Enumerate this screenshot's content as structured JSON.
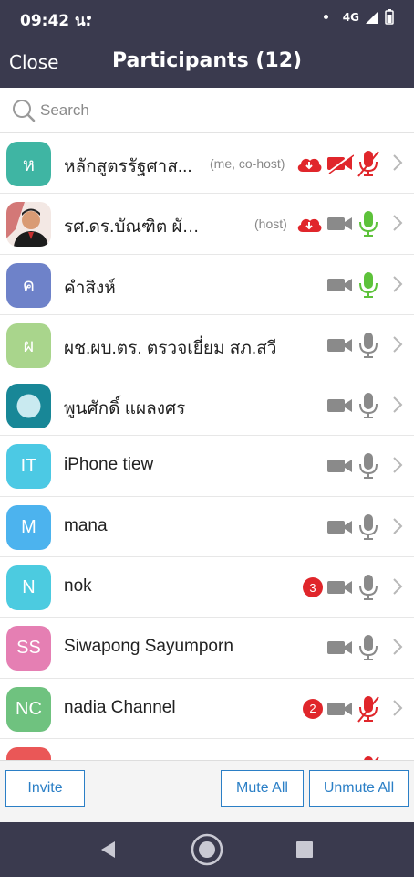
{
  "status_bar": {
    "time": "09:42 น.",
    "network": "4G"
  },
  "header": {
    "close_label": "Close",
    "title": "Participants (12)"
  },
  "search": {
    "placeholder": "Search"
  },
  "colors": {
    "header_bg": "#3a3a4e",
    "accent_blue": "#2b7fc6",
    "red": "#e0262b",
    "green": "#5dc23a",
    "gray_icon": "#8a8a8a"
  },
  "participants": [
    {
      "initials": "ห",
      "avatar_color": "#3fb5a3",
      "name": "หลักสูตรรัฐศาส...",
      "role": "(me, co-host)",
      "cloud": true,
      "video": "off",
      "mic": "muted",
      "chat_badge": ""
    },
    {
      "initials": "",
      "avatar_color": "photo",
      "name": "รศ.ดร.บัณฑิต ผังนิรัน...",
      "role": "(host)",
      "cloud": true,
      "video": "on",
      "mic": "active",
      "chat_badge": ""
    },
    {
      "initials": "ค",
      "avatar_color": "#6e82c9",
      "name": "คำสิงห์",
      "role": "",
      "cloud": false,
      "video": "on",
      "mic": "active",
      "chat_badge": ""
    },
    {
      "initials": "ผ",
      "avatar_color": "#a9d58c",
      "name": "ผช.ผบ.ตร. ตรวจเยี่ยม สภ.สวี",
      "role": "",
      "cloud": false,
      "video": "on",
      "mic": "on",
      "chat_badge": ""
    },
    {
      "initials": "",
      "avatar_color": "#188797",
      "name": "พูนศักดิ์ แผลงศร",
      "role": "",
      "cloud": false,
      "video": "on",
      "mic": "on",
      "chat_badge": ""
    },
    {
      "initials": "IT",
      "avatar_color": "#4cc9e4",
      "name": "iPhone tiew",
      "role": "",
      "cloud": false,
      "video": "on",
      "mic": "on",
      "chat_badge": ""
    },
    {
      "initials": "M",
      "avatar_color": "#4cb3ee",
      "name": "mana",
      "role": "",
      "cloud": false,
      "video": "on",
      "mic": "on",
      "chat_badge": ""
    },
    {
      "initials": "N",
      "avatar_color": "#4ccbe0",
      "name": "nok",
      "role": "",
      "cloud": false,
      "video": "on",
      "mic": "on",
      "chat_badge": "3"
    },
    {
      "initials": "SS",
      "avatar_color": "#e57fb3",
      "name": "Siwapong Sayumporn",
      "role": "",
      "cloud": false,
      "video": "on",
      "mic": "on",
      "chat_badge": ""
    },
    {
      "initials": "NC",
      "avatar_color": "#6fc27f",
      "name": "nadia Channel",
      "role": "",
      "cloud": false,
      "video": "on",
      "mic": "muted",
      "chat_badge": "2"
    },
    {
      "initials": "",
      "avatar_color": "#ea5757",
      "name": "",
      "role": "",
      "cloud": false,
      "video": "on",
      "mic": "muted",
      "chat_badge": ""
    }
  ],
  "footer": {
    "invite_label": "Invite",
    "mute_all_label": "Mute All",
    "unmute_all_label": "Unmute All"
  }
}
